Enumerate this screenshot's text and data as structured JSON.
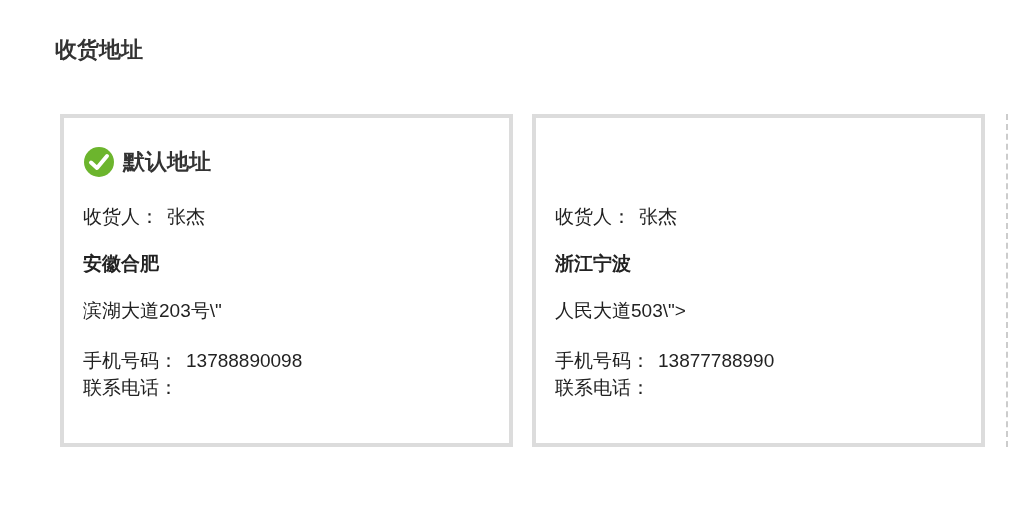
{
  "section_title": "收货地址",
  "cards": [
    {
      "kind": "address",
      "default": true,
      "default_label": "默认地址",
      "consignee_label": "收货人：",
      "consignee": "张杰",
      "region": "安徽合肥",
      "street": "滨湖大道203号\\\"",
      "mobile_label": "手机号码：",
      "mobile": "13788890098",
      "phone_label": "联系电话："
    },
    {
      "kind": "address",
      "default": false,
      "consignee_label": "收货人：",
      "consignee": "张杰",
      "region": "浙江宁波",
      "street": "人民大道503\\\">",
      "mobile_label": "手机号码：",
      "mobile": "13877788990",
      "phone_label": "联系电话："
    },
    {
      "kind": "partial"
    }
  ]
}
